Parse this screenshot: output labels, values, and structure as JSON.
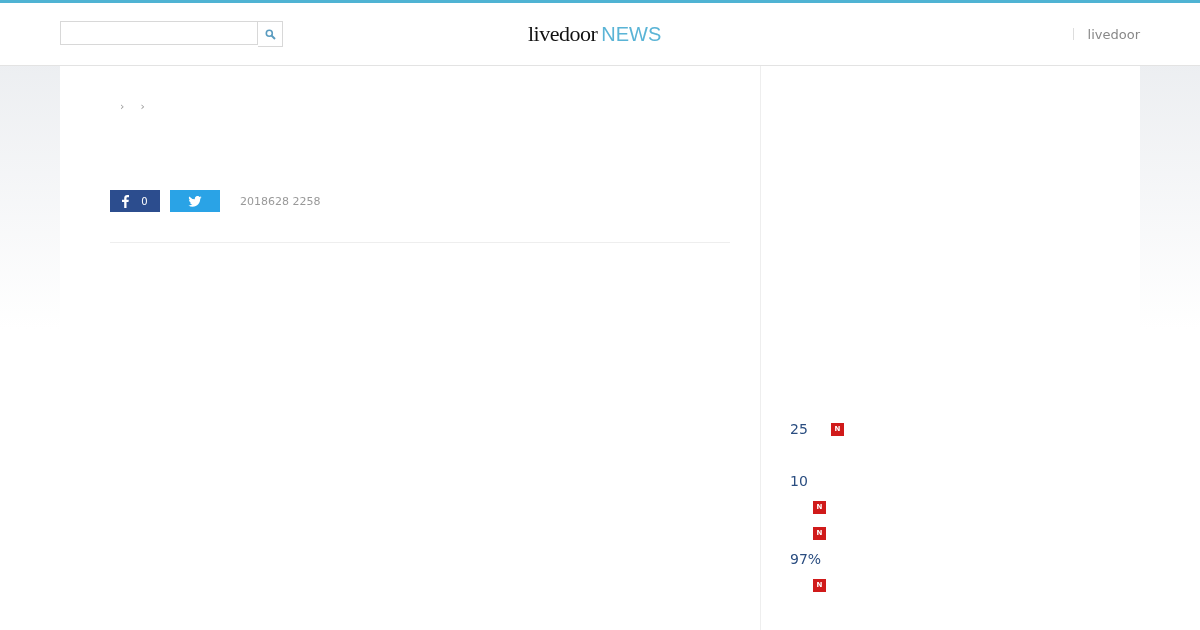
{
  "header": {
    "logo": {
      "brand": "livedoor",
      "product": "NEWS"
    },
    "nav_link": "livedoor"
  },
  "breadcrumb": [
    "›",
    "›"
  ],
  "share": {
    "facebook_count": "0"
  },
  "date": "2018628 2258",
  "sidebar": {
    "items": [
      {
        "text": "25",
        "badge": "N"
      },
      {
        "text": "10"
      },
      {
        "badge": "N"
      },
      {
        "badge": "N"
      },
      {
        "text": "97%"
      },
      {
        "badge": "N"
      }
    ]
  }
}
